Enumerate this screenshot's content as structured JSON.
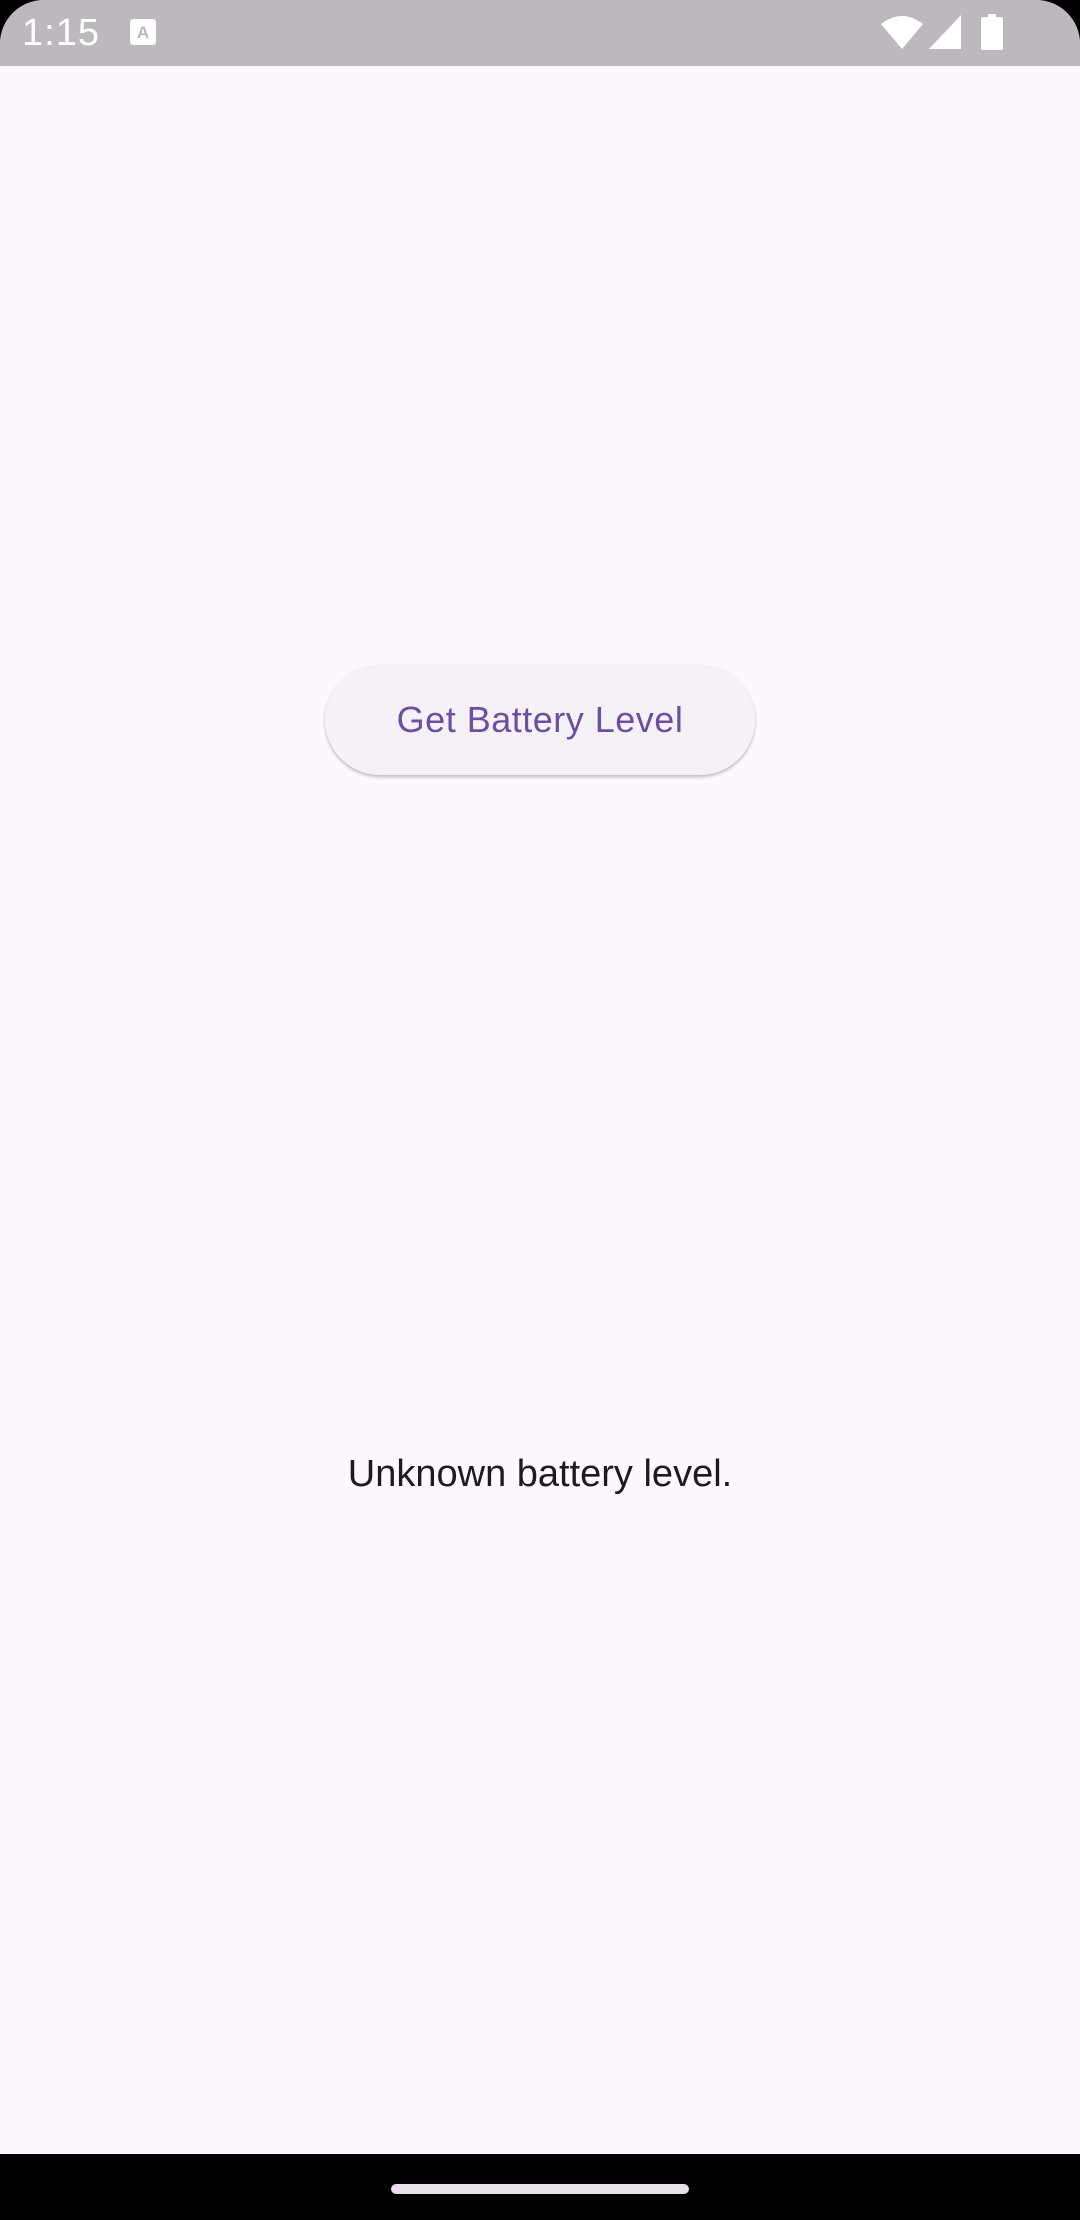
{
  "status_bar": {
    "time": "1:15",
    "icons": [
      "text-a-notification-icon",
      "wifi-icon",
      "cellular-signal-icon",
      "battery-icon"
    ]
  },
  "main": {
    "button_label": "Get Battery Level",
    "battery_status_text": "Unknown battery level."
  },
  "colors": {
    "background": "#fdf7fe",
    "status_bar": "#bcb8bd",
    "button_background": "#f5f1f7",
    "button_text": "#6a4fa2",
    "body_text": "#1d1b20",
    "nav_bar": "#000000"
  }
}
